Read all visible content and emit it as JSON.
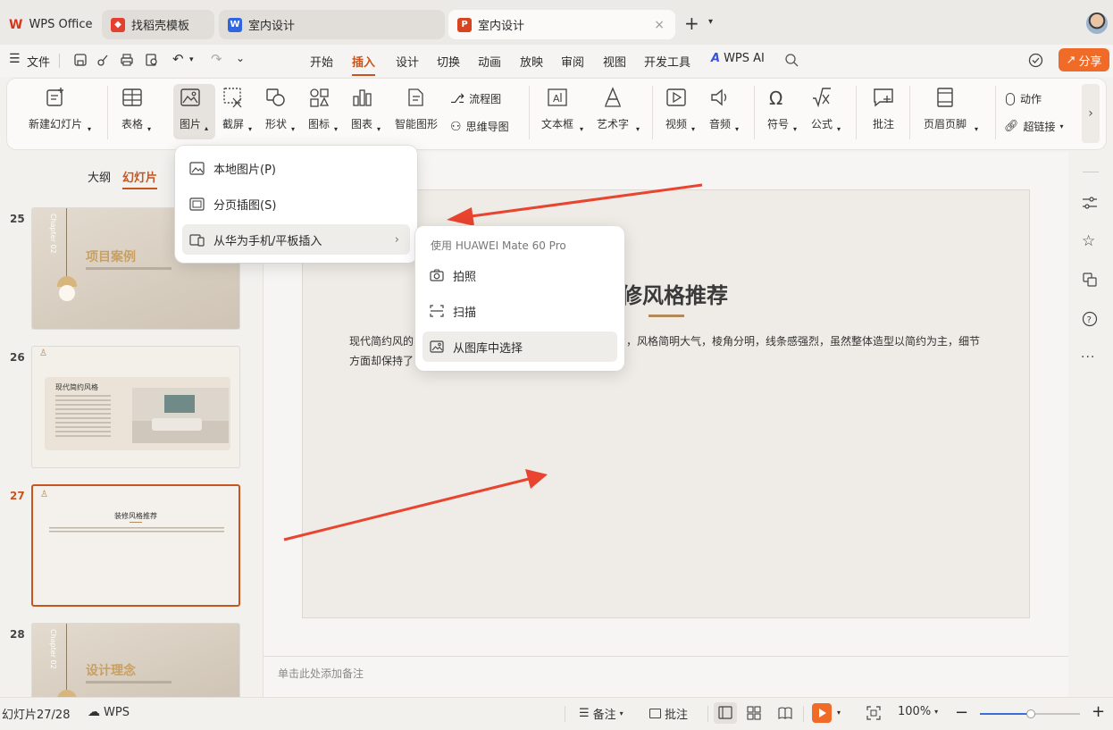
{
  "tabs": {
    "wps_office": "WPS Office",
    "template": "找稻壳模板",
    "doc_w": "室内设计",
    "doc_p": "室内设计"
  },
  "menubar": {
    "file": "文件",
    "items": [
      "开始",
      "插入",
      "设计",
      "切换",
      "动画",
      "放映",
      "审阅",
      "视图",
      "开发工具"
    ],
    "wps_ai": "WPS AI",
    "share": "分享"
  },
  "ribbon": {
    "new_slide": "新建幻灯片",
    "table": "表格",
    "picture": "图片",
    "screenshot": "截屏",
    "shape": "形状",
    "icon": "图标",
    "chart": "图表",
    "smartart": "智能图形",
    "flowchart": "流程图",
    "mindmap": "思维导图",
    "textbox": "文本框",
    "wordart": "艺术字",
    "video": "视频",
    "audio": "音频",
    "symbol": "符号",
    "formula": "公式",
    "comment": "批注",
    "header_footer": "页眉页脚",
    "action": "动作",
    "hyperlink": "超链接"
  },
  "panel": {
    "outline": "大纲",
    "slides": "幻灯片"
  },
  "thumbnails": [
    {
      "num": "25",
      "title": "项目案例",
      "chapter": "Chapter 02"
    },
    {
      "num": "26",
      "title": "现代简约风格"
    },
    {
      "num": "27",
      "title": "装修风格推荐"
    },
    {
      "num": "28",
      "title": "设计理念",
      "chapter": "Chapter 02"
    }
  ],
  "slide": {
    "title": "修风格推荐",
    "body_line1_a": "现代简约风的",
    "body_line1_b": "，风格简明大气，棱角分明，线条感强烈，虽然整体造型以简约为主，细节",
    "body_line2": "方面却保持了",
    "notes_placeholder": "单击此处添加备注"
  },
  "picture_menu": {
    "local": "本地图片(P)",
    "paged": "分页插图(S)",
    "from_huawei": "从华为手机/平板插入"
  },
  "device_menu": {
    "header": "使用 HUAWEI Mate 60 Pro",
    "take_photo": "拍照",
    "scan": "扫描",
    "gallery": "从图库中选择"
  },
  "status": {
    "slide_count": "幻灯片27/28",
    "wps": "WPS",
    "notes": "备注",
    "comment": "批注",
    "zoom": "100%"
  },
  "colors": {
    "accent": "#c8551f",
    "annotation_arrow": "#e8442f"
  }
}
